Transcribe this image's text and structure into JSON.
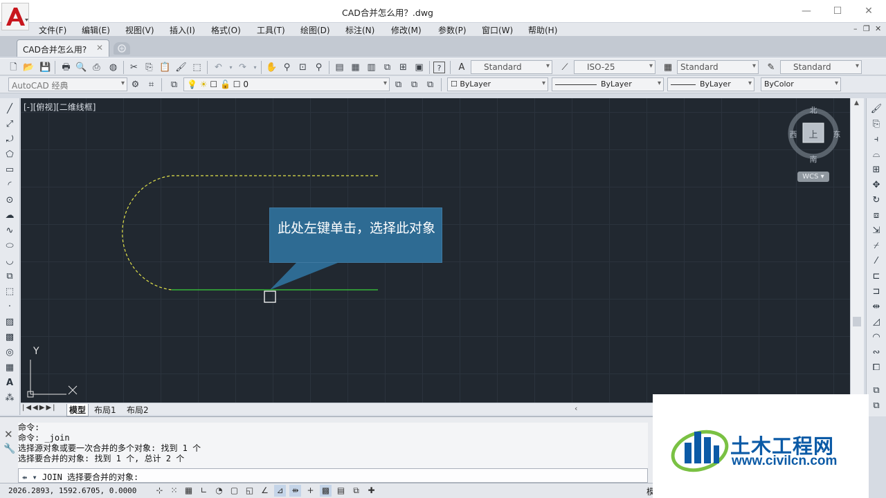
{
  "window": {
    "title": "CAD合并怎么用？.dwg",
    "controls": {
      "minimize": "—",
      "maximize": "☐",
      "close": "✕"
    }
  },
  "menubar": {
    "items": [
      "文件(F)",
      "编辑(E)",
      "视图(V)",
      "插入(I)",
      "格式(O)",
      "工具(T)",
      "绘图(D)",
      "标注(N)",
      "修改(M)",
      "参数(P)",
      "窗口(W)",
      "帮助(H)"
    ],
    "mdi_controls": {
      "minimize": "–",
      "restore": "❐",
      "close": "✕"
    }
  },
  "tabs": {
    "document_tab": "CAD合并怎么用?",
    "close_glyph": "✕"
  },
  "toolbar_styles": {
    "text_style": "Standard",
    "dim_style": "ISO-25",
    "table_style": "Standard",
    "multileader_style": "Standard"
  },
  "toolbar_layers": {
    "workspace": "AutoCAD 经典",
    "current_layer": "0",
    "color": "ByLayer",
    "linetype": "ByLayer",
    "lineweight": "ByLayer",
    "plotstyle": "ByColor"
  },
  "viewport": {
    "label": "[-][俯视][二维线框]"
  },
  "viewcube": {
    "north": "北",
    "south": "南",
    "east": "东",
    "west": "西",
    "face": "上",
    "wcs": "WCS"
  },
  "ucs": {
    "x": "X",
    "y": "Y"
  },
  "callout": {
    "text": "此处左键单击，选择此对象"
  },
  "layout_tabs": {
    "tabs": [
      "模型",
      "布局1",
      "布局2"
    ]
  },
  "command": {
    "history": [
      "命令:",
      "命令: _join",
      "选择源对象或要一次合并的多个对象: 找到 1 个",
      "选择要合并的对象: 找到 1 个, 总计 2 个"
    ],
    "prompt": "JOIN 选择要合并的对象:"
  },
  "statusbar": {
    "coords": "2026.2893, 1592.6705, 0.0000",
    "model_label": "模"
  },
  "watermark": {
    "title": "土木工程网",
    "url": "www.civilcn.com"
  },
  "colors": {
    "canvas_bg": "#212830",
    "selected_dashed": "#e3e34a",
    "line_green": "#3bd13b",
    "callout_bg": "#2e6b93",
    "brand_blue": "#0b5aa6"
  }
}
